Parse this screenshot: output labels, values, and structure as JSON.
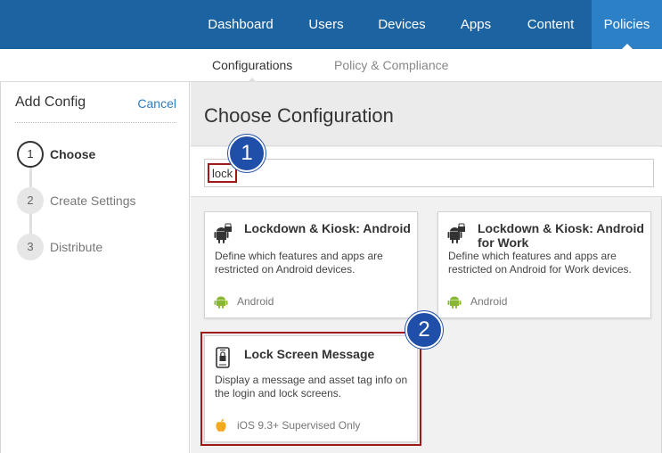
{
  "nav": {
    "tabs": [
      {
        "label": "Dashboard"
      },
      {
        "label": "Users"
      },
      {
        "label": "Devices"
      },
      {
        "label": "Apps"
      },
      {
        "label": "Content"
      },
      {
        "label": "Policies",
        "active": true
      }
    ]
  },
  "subnav": {
    "tabs": [
      {
        "label": "Configurations",
        "active": true
      },
      {
        "label": "Policy & Compliance"
      }
    ]
  },
  "sidebar": {
    "title": "Add Config",
    "cancel_label": "Cancel",
    "steps": [
      {
        "number": "1",
        "label": "Choose",
        "active": true
      },
      {
        "number": "2",
        "label": "Create Settings"
      },
      {
        "number": "3",
        "label": "Distribute"
      }
    ]
  },
  "main": {
    "title": "Choose Configuration",
    "search": {
      "value": "lock"
    },
    "cards": [
      {
        "title": "Lockdown & Kiosk: Android",
        "description": "Define which features and apps are restricted on Android devices.",
        "platform": "Android",
        "icon": "android-lock-icon",
        "platform_icon": "android-icon"
      },
      {
        "title": "Lockdown & Kiosk: Android for Work",
        "description": "Define which features and apps are restricted on Android for Work devices.",
        "platform": "Android",
        "icon": "android-lock-icon",
        "platform_icon": "android-icon"
      },
      {
        "title": "Lock Screen Message",
        "description": "Display a message and asset tag info on the login and lock screens.",
        "platform": "iOS 9.3+ Supervised Only",
        "icon": "phone-lock-icon",
        "platform_icon": "apple-icon"
      }
    ]
  },
  "callouts": [
    {
      "number": "1"
    },
    {
      "number": "2"
    }
  ],
  "colors": {
    "nav_bg": "#1c63a2",
    "nav_active": "#2c80c6",
    "link": "#2c7cc3",
    "highlight": "#a01818",
    "callout": "#1f4fa8",
    "android_green": "#8ab833",
    "apple_orange": "#f2a91e"
  }
}
